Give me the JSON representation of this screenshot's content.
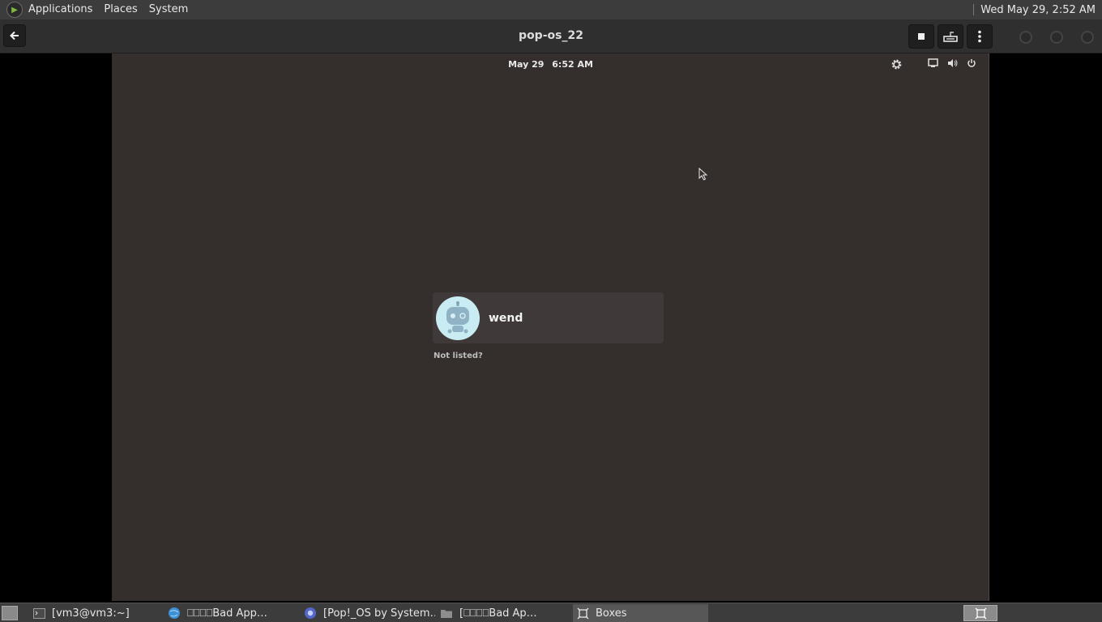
{
  "top_panel": {
    "menus": [
      "Applications",
      "Places",
      "System"
    ],
    "clock": "Wed May 29,  2:52 AM"
  },
  "headerbar": {
    "title": "pop-os_22"
  },
  "vm": {
    "date": "May 29",
    "time": "6:52 AM",
    "user_name": "wend",
    "not_listed": "Not listed?",
    "background_color": "#342e2d",
    "avatar_color": "#c9ecf2"
  },
  "taskbar": {
    "tasks": [
      {
        "label": "[vm3@vm3:~]",
        "icon": "terminal-icon"
      },
      {
        "label": "⎕⎕⎕⎕Bad App…",
        "icon": "globe-icon"
      },
      {
        "label": "[Pop!_OS by System…",
        "icon": "browser-icon"
      },
      {
        "label": "[⎕⎕⎕⎕Bad Ap…",
        "icon": "folder-icon"
      },
      {
        "label": "Boxes",
        "icon": "boxes-icon"
      }
    ]
  }
}
